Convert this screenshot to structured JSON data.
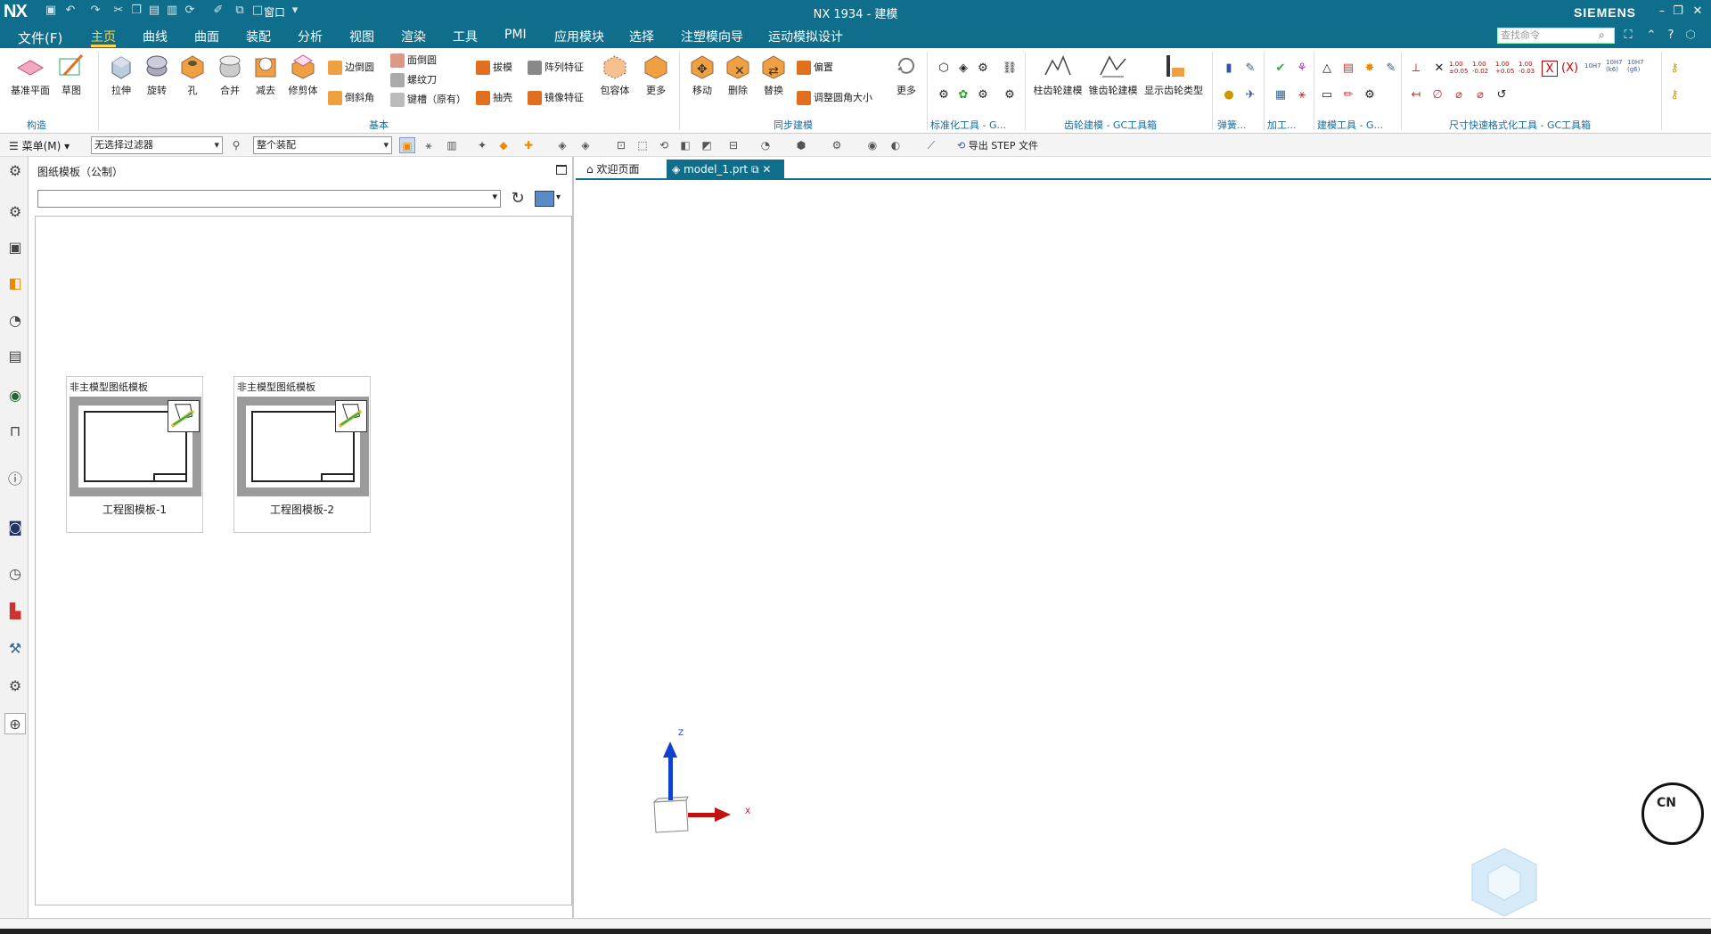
{
  "app": {
    "logo": "NX",
    "title": "NX 1934 - 建模",
    "brand": "SIEMENS"
  },
  "quick_access": {
    "window_label": "窗口"
  },
  "menubar": {
    "file": "文件(F)",
    "tabs": [
      "主页",
      "曲线",
      "曲面",
      "装配",
      "分析",
      "视图",
      "渲染",
      "工具",
      "PMI",
      "应用模块",
      "选择",
      "注塑模向导",
      "运动模拟设计"
    ],
    "active_tab": "主页",
    "search_placeholder": "查找命令"
  },
  "ribbon": {
    "construct": {
      "datum_plane": "基准平面",
      "sketch": "草图",
      "group": "构造"
    },
    "basic": {
      "extrude": "拉伸",
      "revolve": "旋转",
      "hole": "孔",
      "unite": "合并",
      "subtract": "减去",
      "trim_body": "修剪体",
      "edge_blend": "边倒圆",
      "chamfer": "倒斜角",
      "face_blend": "面倒圆",
      "thread": "螺纹刀",
      "groove": "键槽（原有）",
      "draft": "拔模",
      "shell": "抽壳",
      "pattern_feature": "阵列特征",
      "mirror_feature": "镜像特征",
      "wrap_body": "包容体",
      "more": "更多",
      "group": "基本"
    },
    "sync": {
      "move": "移动",
      "delete": "删除",
      "replace": "替换",
      "offset": "偏置",
      "resize_blend": "调整圆角大小",
      "more": "更多",
      "group": "同步建模"
    },
    "std_tools": {
      "group": "标准化工具 - G..."
    },
    "gear": {
      "cyl_gear": "柱齿轮建模",
      "bevel_gear": "锥齿轮建模",
      "show_gear_type": "显示齿轮类型",
      "group": "齿轮建模 - GC工具箱"
    },
    "spring": {
      "group": "弹簧..."
    },
    "machining": {
      "group": "加工..."
    },
    "modeling_tools": {
      "group": "建模工具 - G..."
    },
    "dim_format": {
      "group": "尺寸快速格式化工具 - GC工具箱",
      "tolerances": [
        "1.00 ±0.05",
        "1.00 -0.02",
        "1.00 +0.05",
        "1.00 -0.03"
      ],
      "fits": [
        "10H7",
        "10H7 (k6)",
        "10H7 (g6)"
      ]
    }
  },
  "filterbar": {
    "menu": "菜单(M)",
    "filter": "无选择过滤器",
    "scope": "整个装配",
    "export_step": "导出 STEP 文件"
  },
  "panel": {
    "title": "图纸模板（公制）",
    "dropdown_value": "",
    "cards": [
      {
        "header": "非主模型图纸模板",
        "label": "工程图模板-1"
      },
      {
        "header": "非主模型图纸模板",
        "label": "工程图模板-2"
      }
    ]
  },
  "doc_tabs": {
    "welcome": "欢迎页面",
    "model": "model_1.prt"
  },
  "triad": {
    "z": "Z",
    "x": "X"
  },
  "badge": {
    "text": "CN"
  },
  "colors": {
    "titlebar": "#0f6e8c",
    "accent": "#ffd24a",
    "group_label": "#1a6aa0"
  }
}
